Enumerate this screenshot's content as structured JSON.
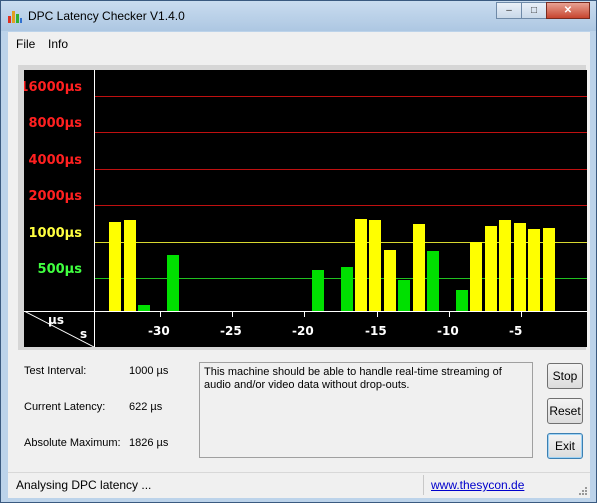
{
  "window": {
    "title": "DPC Latency Checker V1.4.0",
    "controls": {
      "minimize": "–",
      "maximize": "□",
      "close": "✕"
    }
  },
  "menu": {
    "items": [
      "File",
      "Info"
    ]
  },
  "chart_data": {
    "type": "bar",
    "yaxis": {
      "scale": "log",
      "unit_label": "µs",
      "ticks": [
        {
          "label": "16000µs",
          "value": 16000,
          "color": "#ff2020",
          "line": "#c01010"
        },
        {
          "label": "8000µs",
          "value": 8000,
          "color": "#ff2020",
          "line": "#c01010"
        },
        {
          "label": "4000µs",
          "value": 4000,
          "color": "#ff2020",
          "line": "#c01010"
        },
        {
          "label": "2000µs",
          "value": 2000,
          "color": "#ff2020",
          "line": "#c01010"
        },
        {
          "label": "1000µs",
          "value": 1000,
          "color": "#ffff40",
          "line": "#d8d830"
        },
        {
          "label": "500µs",
          "value": 500,
          "color": "#40ff40",
          "line": "#20c020"
        }
      ]
    },
    "xaxis": {
      "unit_label": "s",
      "ticks": [
        {
          "label": "-30",
          "value": -30
        },
        {
          "label": "-25",
          "value": -25
        },
        {
          "label": "-20",
          "value": -20
        },
        {
          "label": "-15",
          "value": -15
        },
        {
          "label": "-10",
          "value": -10
        },
        {
          "label": "-5",
          "value": -5
        }
      ],
      "xlim": [
        -34,
        -1
      ]
    },
    "colors": {
      "green": "#00e000",
      "yellow": "#ffff00"
    },
    "bars": [
      {
        "x": -33,
        "value": 1450,
        "color": "yellow"
      },
      {
        "x": -32,
        "value": 1500,
        "color": "yellow"
      },
      {
        "x": -31,
        "value": 300,
        "color": "green"
      },
      {
        "x": -30,
        "value": 190,
        "color": "green"
      },
      {
        "x": -29,
        "value": 780,
        "color": "green"
      },
      {
        "x": -28,
        "value": 235,
        "color": "green"
      },
      {
        "x": -27,
        "value": 195,
        "color": "green"
      },
      {
        "x": -26,
        "value": 205,
        "color": "green"
      },
      {
        "x": -25,
        "value": 220,
        "color": "green"
      },
      {
        "x": -24,
        "value": 225,
        "color": "green"
      },
      {
        "x": -23,
        "value": 230,
        "color": "green"
      },
      {
        "x": -22,
        "value": 250,
        "color": "green"
      },
      {
        "x": -21,
        "value": 240,
        "color": "green"
      },
      {
        "x": -20,
        "value": 260,
        "color": "green"
      },
      {
        "x": -19,
        "value": 580,
        "color": "green"
      },
      {
        "x": -18,
        "value": 195,
        "color": "green"
      },
      {
        "x": -17,
        "value": 620,
        "color": "green"
      },
      {
        "x": -16,
        "value": 1540,
        "color": "yellow"
      },
      {
        "x": -15,
        "value": 1500,
        "color": "yellow"
      },
      {
        "x": -14,
        "value": 860,
        "color": "yellow"
      },
      {
        "x": -13,
        "value": 480,
        "color": "green"
      },
      {
        "x": -12,
        "value": 1400,
        "color": "yellow"
      },
      {
        "x": -11,
        "value": 830,
        "color": "green"
      },
      {
        "x": -10,
        "value": 160,
        "color": "green"
      },
      {
        "x": -9,
        "value": 400,
        "color": "green"
      },
      {
        "x": -8,
        "value": 1000,
        "color": "yellow"
      },
      {
        "x": -7,
        "value": 1350,
        "color": "yellow"
      },
      {
        "x": -6,
        "value": 1500,
        "color": "yellow"
      },
      {
        "x": -5,
        "value": 1420,
        "color": "yellow"
      },
      {
        "x": -4,
        "value": 1280,
        "color": "yellow"
      },
      {
        "x": -3,
        "value": 1300,
        "color": "yellow"
      },
      {
        "x": -2,
        "value": 260,
        "color": "green"
      },
      {
        "x": -1,
        "value": 170,
        "color": "green"
      }
    ]
  },
  "info": {
    "test_interval_label": "Test Interval:",
    "test_interval_value": "1000 µs",
    "current_latency_label": "Current Latency:",
    "current_latency_value": "622 µs",
    "absolute_max_label": "Absolute Maximum:",
    "absolute_max_value": "1826 µs"
  },
  "message": "This machine should be able to handle real-time streaming of audio and/or video data without drop-outs.",
  "buttons": {
    "stop": "Stop",
    "reset": "Reset",
    "exit": "Exit"
  },
  "status": {
    "text": "Analysing DPC latency ...",
    "link": "www.thesycon.de"
  }
}
